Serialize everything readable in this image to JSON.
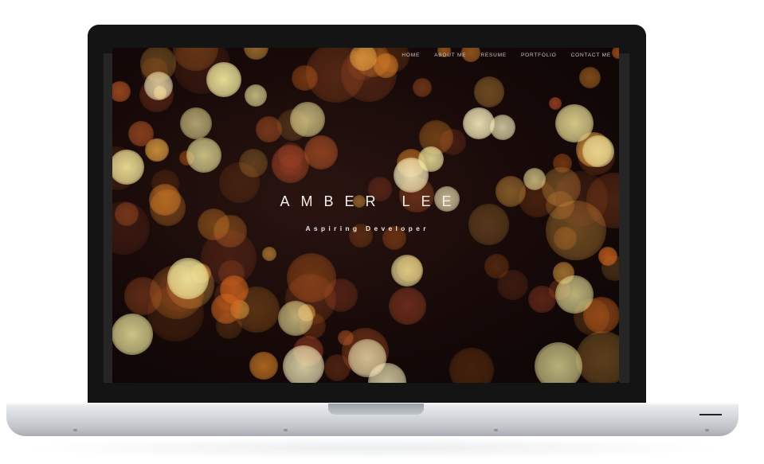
{
  "nav": {
    "items": [
      "HOME",
      "ABOUT ME",
      "RESUME",
      "PORTFOLIO",
      "CONTACT ME"
    ]
  },
  "hero": {
    "name": "AMBER LEE",
    "tagline": "Aspiring Developer"
  },
  "colors": {
    "background_dark": "#160908",
    "bokeh_warm": "#e88a2a",
    "bokeh_pale": "#f3eba0",
    "text_light": "#f4f0ec"
  }
}
